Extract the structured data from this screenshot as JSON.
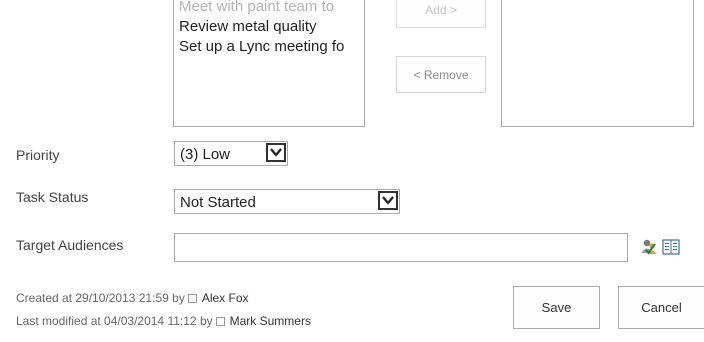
{
  "tasks_picker": {
    "source_items": [
      "Meet with paint team to",
      "Review metal quality",
      "Set up a Lync meeting fo"
    ],
    "add_label": "Add >",
    "remove_label": "< Remove"
  },
  "priority": {
    "label": "Priority",
    "value": "(3) Low"
  },
  "task_status": {
    "label": "Task Status",
    "value": "Not Started"
  },
  "target_audiences": {
    "label": "Target Audiences",
    "value": "",
    "icons": [
      "check-names-icon",
      "browse-directory-icon"
    ]
  },
  "footer": {
    "created_prefix": "Created at 29/10/2013 21:59",
    "created_by_word": "by",
    "created_user": "Alex Fox",
    "modified_prefix": "Last modified at 04/03/2014 11:12",
    "modified_by_word": "by",
    "modified_user": "Mark Summers",
    "save_label": "Save",
    "cancel_label": "Cancel"
  }
}
